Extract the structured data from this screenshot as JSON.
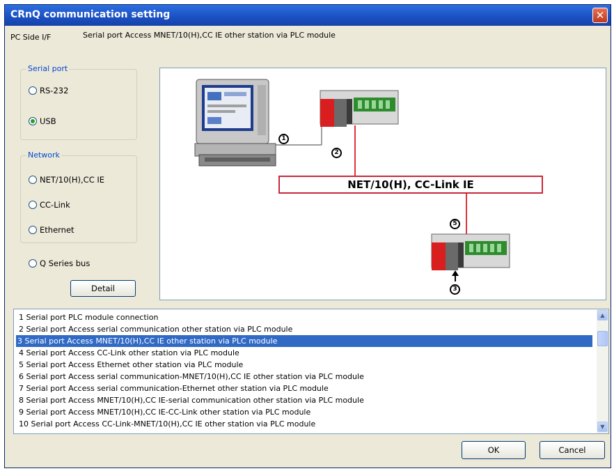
{
  "window": {
    "title": "CRnQ communication setting",
    "close_glyph": "✕"
  },
  "header": {
    "pc_side_label": "PC Side I/F",
    "description": "Serial port Access MNET/10(H),CC IE other station via PLC module"
  },
  "serial_port": {
    "group_title": "Serial port",
    "options": [
      {
        "label": "RS-232",
        "selected": false
      },
      {
        "label": "USB",
        "selected": true
      }
    ]
  },
  "network": {
    "group_title": "Network",
    "options": [
      {
        "label": "NET/10(H),CC IE",
        "selected": false
      },
      {
        "label": "CC-Link",
        "selected": false
      },
      {
        "label": "Ethernet",
        "selected": false
      }
    ]
  },
  "q_series_bus": {
    "label": "Q Series bus",
    "selected": false
  },
  "detail_button": "Detail",
  "diagram": {
    "network_label": "NET/10(H), CC-Link IE",
    "markers": [
      "1",
      "2",
      "5",
      "3"
    ],
    "link_color": "#e0323c"
  },
  "route_list": {
    "items": [
      "1 Serial port PLC module connection",
      "2 Serial port Access serial communication other station via PLC module",
      "3 Serial port Access MNET/10(H),CC IE other station via PLC module",
      "4 Serial port Access CC-Link other station via PLC module",
      "5 Serial port Access Ethernet other station via PLC module",
      "6 Serial port Access serial communication-MNET/10(H),CC IE other station via PLC module",
      "7 Serial port Access serial communication-Ethernet other station via PLC module",
      "8 Serial port Access MNET/10(H),CC IE-serial communication other station via PLC module",
      "9 Serial port Access MNET/10(H),CC IE-CC-Link other station via PLC module",
      "10 Serial port Access CC-Link-MNET/10(H),CC IE other station via PLC module"
    ],
    "selected_index": 2
  },
  "buttons": {
    "ok": "OK",
    "cancel": "Cancel"
  },
  "colors": {
    "title_bar": "#1b4fc1",
    "selection": "#316ac5",
    "group_title": "#0046d5",
    "dialog_bg": "#ece9d8"
  },
  "icons": {
    "close": "close-icon",
    "scroll_up": "scroll-up-icon",
    "scroll_down": "scroll-down-icon",
    "pc": "personal-computer-icon",
    "plc": "plc-module-icon",
    "arrow": "arrow-up-icon"
  }
}
